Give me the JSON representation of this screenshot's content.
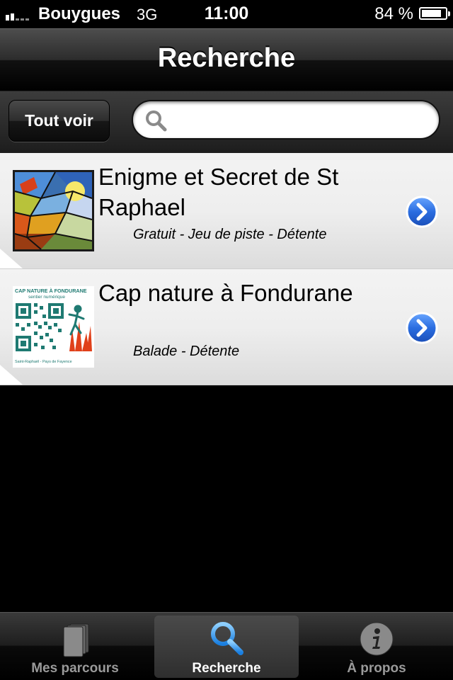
{
  "status_bar": {
    "carrier": "Bouygues",
    "network": "3G",
    "time": "11:00",
    "battery": "84 %"
  },
  "nav": {
    "title": "Recherche"
  },
  "search": {
    "button_label": "Tout voir",
    "value": "",
    "placeholder": ""
  },
  "list": {
    "items": [
      {
        "title": "Enigme et Secret de St Raphael",
        "subtitle": "Gratuit - Jeu de piste - Détente",
        "thumbnail": "stained-glass-image"
      },
      {
        "title": "Cap nature à Fondurane",
        "subtitle": "Balade - Détente",
        "thumbnail": "qr-code-logo",
        "thumb_text_top": "CAP NATURE À FONDURANE",
        "thumb_text_mid": "sentier numérique",
        "thumb_text_bottom": "Saint-Raphaël - Pays de Fayence"
      }
    ]
  },
  "tab_bar": {
    "tabs": [
      {
        "label": "Mes parcours",
        "icon": "pages-icon"
      },
      {
        "label": "Recherche",
        "icon": "search-icon",
        "selected": true
      },
      {
        "label": "À propos",
        "icon": "info-icon"
      }
    ]
  },
  "colors": {
    "disclosure_blue": "#2a6de0",
    "qr_green": "#1f7a72",
    "list_background": "#eeeeee"
  }
}
